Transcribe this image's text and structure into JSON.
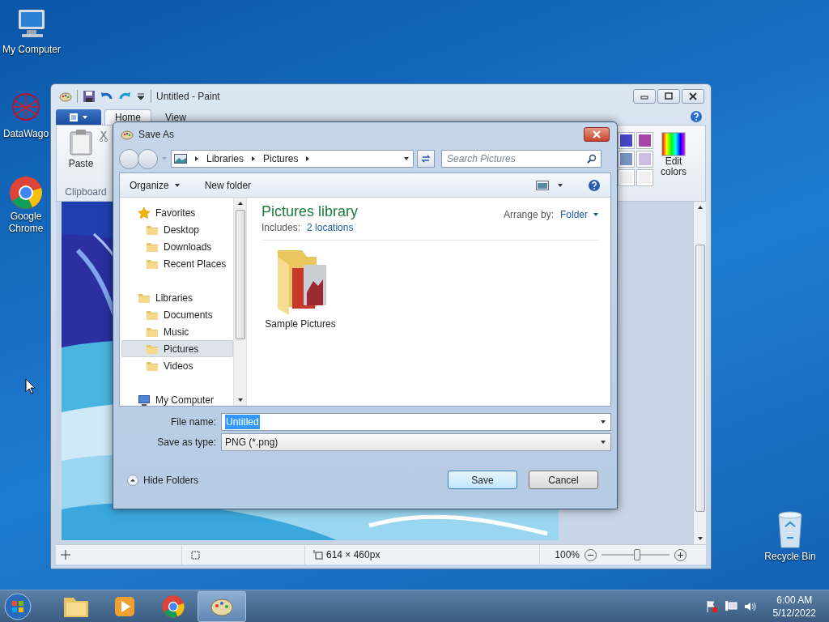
{
  "desktop_icons": [
    {
      "label": "My Computer"
    },
    {
      "label": "DataWago"
    },
    {
      "label": "Google Chrome"
    },
    {
      "label": "Recycle Bin"
    }
  ],
  "paint": {
    "title": "Untitled - Paint",
    "tabs": [
      {
        "label": "Home",
        "selected": true
      },
      {
        "label": "View",
        "selected": false
      }
    ],
    "paste": "Paste",
    "clipboard_group": "Clipboard",
    "palette": [
      {
        "color": "#4646c8"
      },
      {
        "color": "#a845a8"
      },
      {
        "color": "#7894c4"
      },
      {
        "color": "#cbbde4"
      },
      {
        "color": "#f0f0f0"
      },
      {
        "color": "#f0f0f0"
      }
    ],
    "edit_colors": "Edit colors",
    "status_bar": {
      "size": "614 × 460px",
      "zoom": "100%",
      "zoom_level": {
        "level": 0.52
      }
    }
  },
  "dialog": {
    "title": "Save As",
    "breadcrumb": [
      "Libraries",
      "Pictures"
    ],
    "search": {
      "placeholder": "Search Pictures"
    },
    "toolbar": [
      "Organize",
      "New folder"
    ],
    "nav": [
      {
        "label": "Favorites",
        "selected": false,
        "children": [
          {
            "label": "Desktop",
            "selected": false
          },
          {
            "label": "Downloads",
            "selected": false
          },
          {
            "label": "Recent Places",
            "selected": false
          }
        ]
      },
      {
        "label": "Libraries",
        "selected": false,
        "children": [
          {
            "label": "Documents",
            "selected": false
          },
          {
            "label": "Music",
            "selected": false
          },
          {
            "label": "Pictures",
            "selected": true
          },
          {
            "label": "Videos",
            "selected": false
          }
        ]
      },
      {
        "label": "My Computer",
        "selected": false
      }
    ],
    "library_title": "Pictures library",
    "includes": "Includes:",
    "locations": "2 locations",
    "arrange_label": "Arrange by:",
    "arrange_value": "Folder",
    "items": [
      {
        "label": "Sample Pictures"
      }
    ],
    "file_name": {
      "label": "File name:",
      "value": "Untitled"
    },
    "file_type": {
      "label": "Save as type:",
      "value": "PNG (*.png)"
    },
    "hide_folders": "Hide Folders",
    "buttons": [
      "Save",
      "Cancel"
    ]
  },
  "taskbar": {
    "time": "6:00 AM",
    "date": "5/12/2022"
  }
}
